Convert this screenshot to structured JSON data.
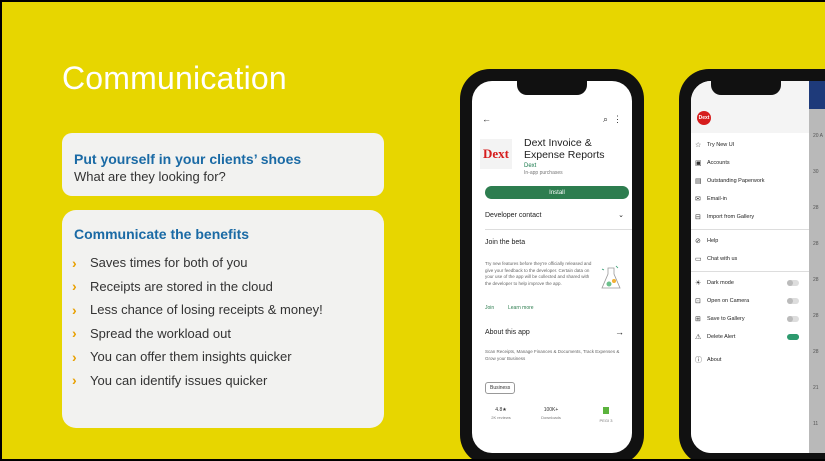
{
  "slide": {
    "title": "Communication",
    "card1": {
      "heading": "Put yourself in your clients’ shoes",
      "sub": "What are they looking for?"
    },
    "card2": {
      "heading": "Communicate the benefits",
      "items": [
        "Saves times for both of you",
        "Receipts are stored in the cloud",
        "Less chance of losing receipts & money!",
        "Spread the workload out",
        "You can offer them insights quicker",
        "You can identify issues quicker"
      ]
    }
  },
  "phone1": {
    "back_icon": "←",
    "search_icon": "⌕",
    "more_icon": "⋮",
    "app_icon_text": "Dext",
    "app_name": "Dext Invoice & Expense Reports",
    "developer": "Dext",
    "iap": "In-app purchases",
    "install": "Install",
    "developer_contact": "Developer contact",
    "join_beta": "Join the beta",
    "beta_text": "Try new features before they're officially released and give your feedback to the developer. Certain data on your use of the app will be collected and shared with the developer to help improve the app.",
    "join": "Join",
    "learn_more": "Learn more",
    "about": "About this app",
    "about_text": "Scan Receipts, Manage Finances & Documents, Track Expenses & Grow your Business",
    "chip": "Business",
    "rating": "4.8★",
    "reviews": "2K reviews",
    "downloads": "100K+",
    "downloads_label": "Downloads",
    "pegi": "PEGI 3"
  },
  "phone2": {
    "logo": "Dext",
    "menu": [
      {
        "icon": "☆",
        "label": "Try New UI"
      },
      {
        "icon": "▣",
        "label": "Accounts"
      },
      {
        "icon": "▤",
        "label": "Outstanding Paperwork"
      },
      {
        "icon": "✉",
        "label": "Email-in"
      },
      {
        "icon": "⊟",
        "label": "Import from Gallery"
      },
      {
        "icon": "⊘",
        "label": "Help"
      },
      {
        "icon": "▭",
        "label": "Chat with us"
      },
      {
        "icon": "☀",
        "label": "Dark mode"
      },
      {
        "icon": "⊡",
        "label": "Open on Camera"
      },
      {
        "icon": "⊞",
        "label": "Save to Gallery"
      },
      {
        "icon": "⚠",
        "label": "Delete Alert"
      },
      {
        "icon": "ⓘ",
        "label": "About"
      }
    ],
    "side_dates": [
      "20 A",
      "30",
      "28",
      "28",
      "28",
      "28",
      "28",
      "21",
      "11"
    ]
  }
}
